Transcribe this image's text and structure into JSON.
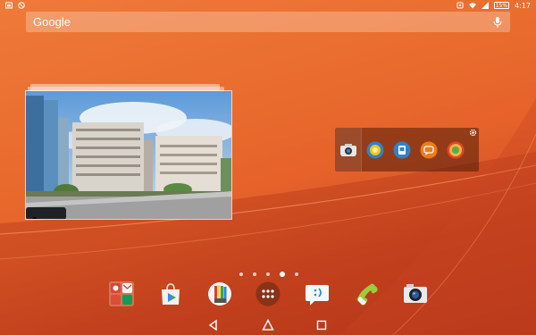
{
  "status_bar": {
    "time": "4:17",
    "battery": "15%",
    "left_icons": [
      "screenshot-icon",
      "no-sim-icon"
    ],
    "right_icons": [
      "nfc-icon",
      "wifi-icon",
      "signal-icon",
      "battery-icon"
    ]
  },
  "search": {
    "label": "Google",
    "icons": [
      "mic-icon"
    ]
  },
  "widgets": {
    "photo": {
      "icon": "photo-icon"
    },
    "apps": {
      "icons": [
        "camera-icon",
        "flashlight-icon",
        "storage-icon",
        "messaging-icon",
        "gallery-icon"
      ],
      "settings_icon": "gear-icon"
    }
  },
  "pager": {
    "count": 5,
    "active": 4
  },
  "dock": {
    "apps": [
      {
        "icon": "google-apps-folder-icon"
      },
      {
        "icon": "play-store-icon"
      },
      {
        "icon": "sketch-icon"
      },
      {
        "icon": "app-drawer-icon"
      },
      {
        "icon": "messages-icon"
      },
      {
        "icon": "phone-icon"
      },
      {
        "icon": "camera-icon"
      }
    ]
  },
  "nav": {
    "buttons": [
      "back-icon",
      "home-icon",
      "recents-icon"
    ]
  },
  "colors": {
    "wallpaper_top": "#ee7a3a",
    "wallpaper_bottom": "#b93a1c",
    "widget_bg": "#5a2510",
    "text": "#ffffff"
  }
}
